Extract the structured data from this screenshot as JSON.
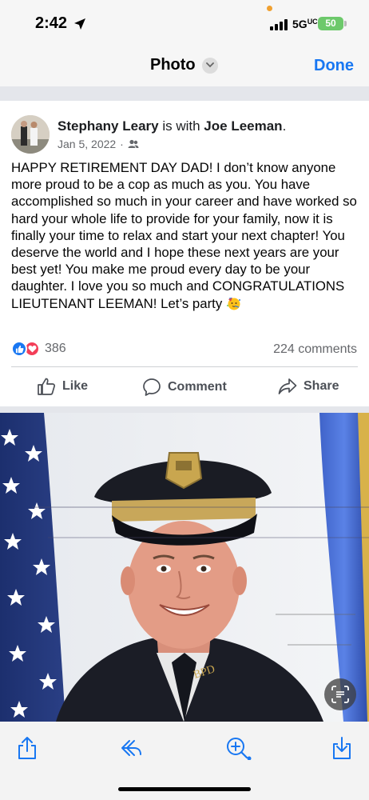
{
  "status_bar": {
    "time": "2:42",
    "network": "5G",
    "battery": "50"
  },
  "nav": {
    "title": "Photo",
    "done_label": "Done"
  },
  "post": {
    "author": "Stephany Leary",
    "with_text": " is with ",
    "tagged": "Joe Leeman",
    "tagged_suffix": ".",
    "date": "Jan 5, 2022",
    "date_separator": "·",
    "audience_icon": "friends-icon",
    "body": "HAPPY RETIREMENT DAY DAD! I don’t know anyone more proud to be a cop as much as you. You have accomplished so much in your career and have worked so hard your whole life to provide for your family, now it is finally your time to relax and start your next chapter! You deserve the world and I hope these next years are your best yet! You make me proud every day to be your daughter. I love you so much and CONGRATULATIONS LIEUTENANT LEEMAN! Let’s party",
    "body_emoji": "partying-face-emoji",
    "reaction_count": "386",
    "comment_count": "224 comments",
    "actions": {
      "like": "Like",
      "comment": "Comment",
      "share": "Share"
    }
  },
  "photo": {
    "subject": "police-officer-portrait",
    "badge_text": "BPD"
  },
  "toolbar": {
    "icons": [
      "share-icon",
      "reply-icon",
      "zoom-icon",
      "download-icon"
    ]
  },
  "colors": {
    "accent": "#1877f2",
    "love": "#f33e58",
    "battery": "#6dc96b"
  }
}
